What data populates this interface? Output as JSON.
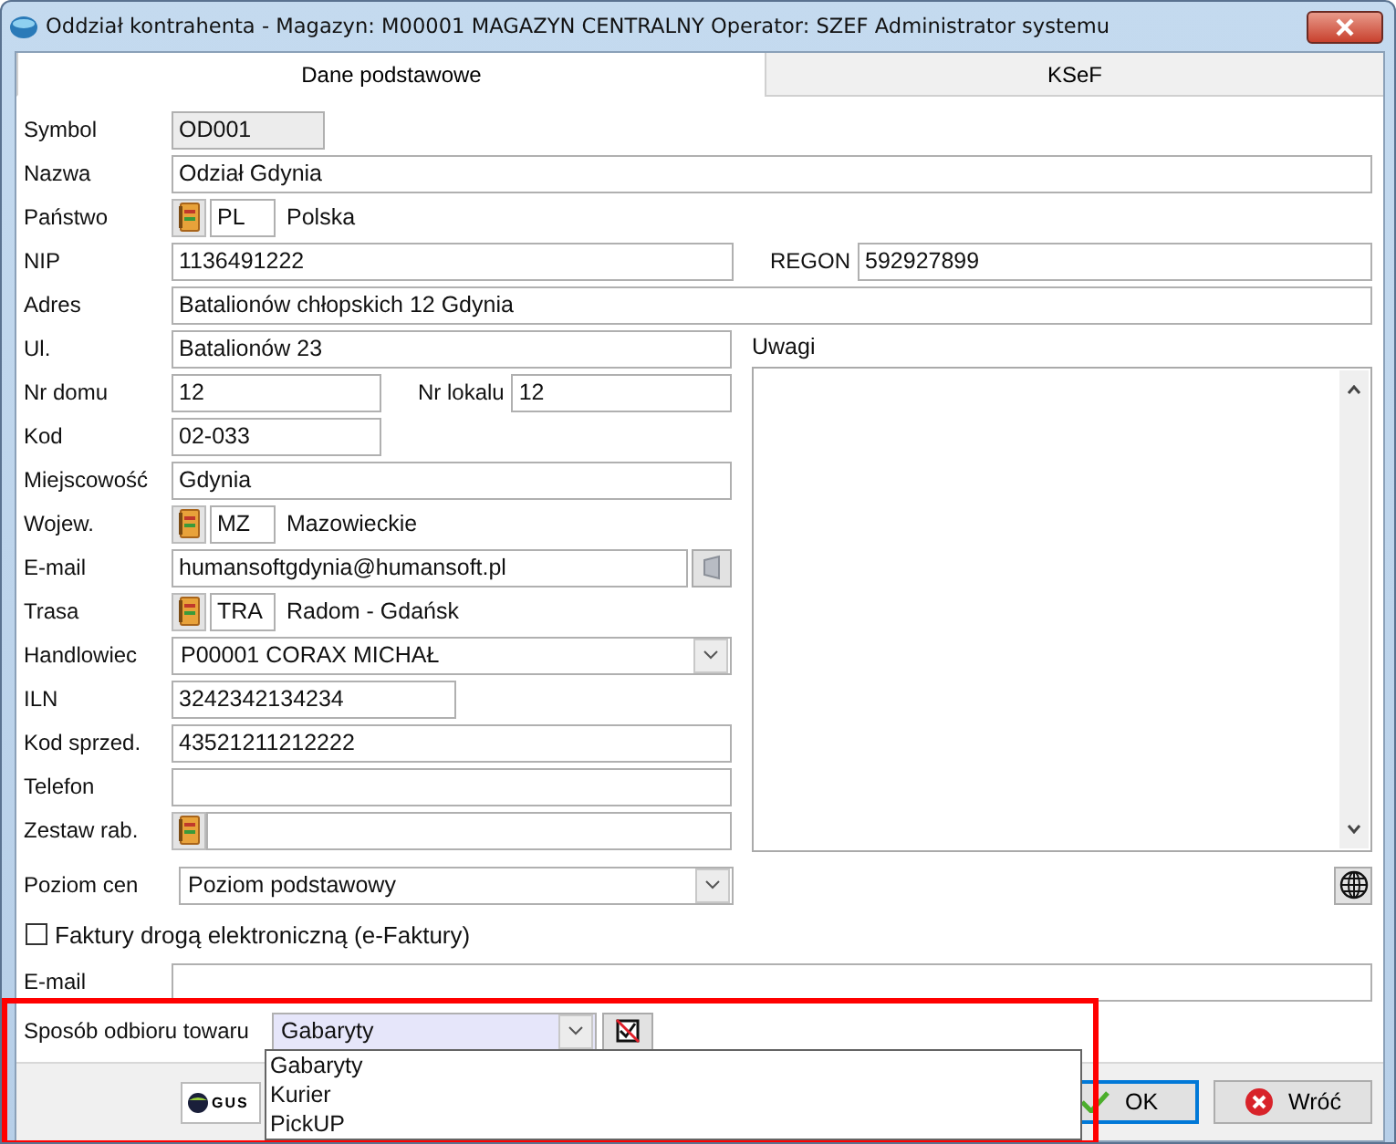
{
  "window": {
    "title": "Oddział kontrahenta - Magazyn: M00001 MAGAZYN CENTRALNY  Operator:  SZEF Administrator systemu"
  },
  "tabs": [
    {
      "label": "Dane podstawowe",
      "selected": true
    },
    {
      "label": "KSeF",
      "selected": false
    }
  ],
  "top_fields": [
    {
      "label": "Symbol",
      "kind": "readonly",
      "value": "OD001"
    },
    {
      "label": "Nazwa",
      "kind": "text",
      "value": "Odział Gdynia"
    },
    {
      "label": "Państwo",
      "kind": "lookup",
      "code": "PL",
      "name": "Polska"
    },
    {
      "label": "NIP",
      "kind": "pair",
      "value": "1136491222",
      "second_label": "REGON",
      "second_value": "592927899"
    },
    {
      "label": "Adres",
      "kind": "text",
      "value": "Batalionów chłopskich 12 Gdynia"
    }
  ],
  "left_fields": [
    {
      "label": "Ul.",
      "kind": "text",
      "value": "Batalionów 23"
    },
    {
      "label": "Nr domu",
      "kind": "pair",
      "value": "12",
      "second_label": "Nr lokalu",
      "second_value": "12"
    },
    {
      "label": "Kod",
      "kind": "short",
      "value": "02-033"
    },
    {
      "label": "Miejscowość",
      "kind": "text",
      "value": "Gdynia"
    },
    {
      "label": "Wojew.",
      "kind": "lookup",
      "code": "MZ",
      "name": "Mazowieckie"
    },
    {
      "label": "E-mail",
      "kind": "email",
      "value": "humansoftgdynia@humansoft.pl"
    },
    {
      "label": "Trasa",
      "kind": "lookup",
      "code": "TRA",
      "name": "Radom - Gdańsk"
    },
    {
      "label": "Handlowiec",
      "kind": "combo",
      "value": "P00001 CORAX MICHAŁ"
    },
    {
      "label": "ILN",
      "kind": "medium",
      "value": "3242342134234"
    },
    {
      "label": "Kod sprzed.",
      "kind": "text",
      "value": "43521211212222"
    },
    {
      "label": "Telefon",
      "kind": "text"
    },
    {
      "label": "Zestaw rab.",
      "kind": "lookup_wide"
    }
  ],
  "notes": {
    "label": "Uwagi"
  },
  "price_level": {
    "label": "Poziom cen",
    "value": "Poziom podstawowy"
  },
  "e_invoice": {
    "label": "Faktury drogą elektroniczną (e-Faktury)",
    "checked": false
  },
  "invoice_email": {
    "label": "E-mail"
  },
  "pickup": {
    "label": "Sposób odbioru towaru",
    "value": "Gabaryty",
    "options": [
      {
        "label": "Gabaryty"
      },
      {
        "label": "Kurier"
      },
      {
        "label": "PickUP"
      }
    ]
  },
  "buttons": [
    {
      "label": "GUS",
      "kind": "gus"
    },
    {
      "label": "OK",
      "kind": "ok"
    },
    {
      "label": "Wróć",
      "kind": "back"
    }
  ]
}
